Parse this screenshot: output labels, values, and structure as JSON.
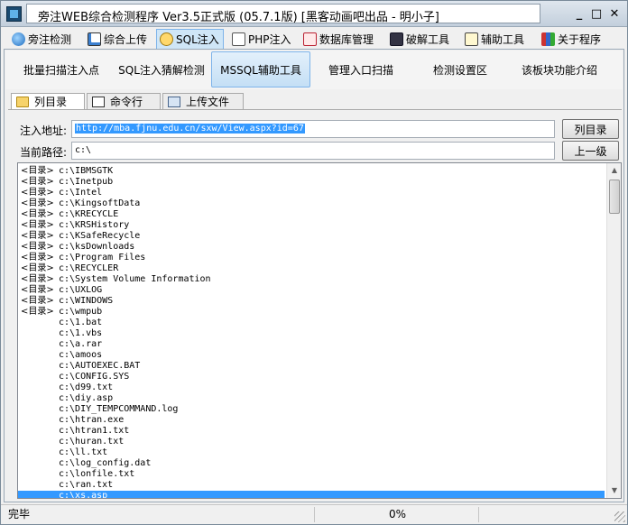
{
  "window": {
    "title": "旁注WEB综合检测程序 Ver3.5正式版 (05.7.1版) [黑客动画吧出品 - 明小子]",
    "minimize_label": "_",
    "maximize_label": "□",
    "close_label": "✕"
  },
  "main_tabs": [
    {
      "label": "旁注检测",
      "icon": "globe-icon"
    },
    {
      "label": "综合上传",
      "icon": "chart-icon"
    },
    {
      "label": "SQL注入",
      "icon": "search-icon",
      "active": true
    },
    {
      "label": "PHP注入",
      "icon": "document-icon"
    },
    {
      "label": "数据库管理",
      "icon": "database-icon"
    },
    {
      "label": "破解工具",
      "icon": "keyboard-icon"
    },
    {
      "label": "辅助工具",
      "icon": "notepad-icon"
    },
    {
      "label": "关于程序",
      "icon": "books-icon"
    }
  ],
  "sub_buttons": [
    {
      "label": "批量扫描注入点"
    },
    {
      "label": "SQL注入猜解检测"
    },
    {
      "label": "MSSQL辅助工具",
      "active": true
    },
    {
      "label": "管理入口扫描"
    },
    {
      "label": "检测设置区"
    },
    {
      "label": "该板块功能介绍"
    }
  ],
  "inner_tabs": [
    {
      "label": "列目录",
      "icon": "folder-icon",
      "active": true
    },
    {
      "label": "命令行",
      "icon": "command-icon"
    },
    {
      "label": "上传文件",
      "icon": "upload-icon"
    }
  ],
  "form": {
    "url_label": "注入地址:",
    "url_value": "http://mba.fjnu.edu.cn/sxw/View.aspx?id=67",
    "path_label": "当前路径:",
    "path_value": "c:\\",
    "list_dir_button": "列目录",
    "up_level_button": "上一级"
  },
  "listing": {
    "dir_tag": "<目录>",
    "entries": [
      {
        "is_dir": true,
        "path": "c:\\IBMSGTK"
      },
      {
        "is_dir": true,
        "path": "c:\\Inetpub"
      },
      {
        "is_dir": true,
        "path": "c:\\Intel"
      },
      {
        "is_dir": true,
        "path": "c:\\KingsoftData"
      },
      {
        "is_dir": true,
        "path": "c:\\KRECYCLE"
      },
      {
        "is_dir": true,
        "path": "c:\\KRSHistory"
      },
      {
        "is_dir": true,
        "path": "c:\\KSafeRecycle"
      },
      {
        "is_dir": true,
        "path": "c:\\ksDownloads"
      },
      {
        "is_dir": true,
        "path": "c:\\Program Files"
      },
      {
        "is_dir": true,
        "path": "c:\\RECYCLER"
      },
      {
        "is_dir": true,
        "path": "c:\\System Volume Information"
      },
      {
        "is_dir": true,
        "path": "c:\\UXLOG"
      },
      {
        "is_dir": true,
        "path": "c:\\WINDOWS"
      },
      {
        "is_dir": true,
        "path": "c:\\wmpub"
      },
      {
        "is_dir": false,
        "path": "c:\\1.bat"
      },
      {
        "is_dir": false,
        "path": "c:\\1.vbs"
      },
      {
        "is_dir": false,
        "path": "c:\\a.rar"
      },
      {
        "is_dir": false,
        "path": "c:\\amoos"
      },
      {
        "is_dir": false,
        "path": "c:\\AUTOEXEC.BAT"
      },
      {
        "is_dir": false,
        "path": "c:\\CONFIG.SYS"
      },
      {
        "is_dir": false,
        "path": "c:\\d99.txt"
      },
      {
        "is_dir": false,
        "path": "c:\\diy.asp"
      },
      {
        "is_dir": false,
        "path": "c:\\DIY_TEMPCOMMAND.log"
      },
      {
        "is_dir": false,
        "path": "c:\\htran.exe"
      },
      {
        "is_dir": false,
        "path": "c:\\htran1.txt"
      },
      {
        "is_dir": false,
        "path": "c:\\huran.txt"
      },
      {
        "is_dir": false,
        "path": "c:\\ll.txt"
      },
      {
        "is_dir": false,
        "path": "c:\\log_config.dat"
      },
      {
        "is_dir": false,
        "path": "c:\\lonfile.txt"
      },
      {
        "is_dir": false,
        "path": "c:\\ran.txt"
      },
      {
        "is_dir": false,
        "path": "c:\\xs.asp",
        "selected": true
      }
    ]
  },
  "status": {
    "state": "完毕",
    "progress_text": "0%",
    "progress": 0
  }
}
